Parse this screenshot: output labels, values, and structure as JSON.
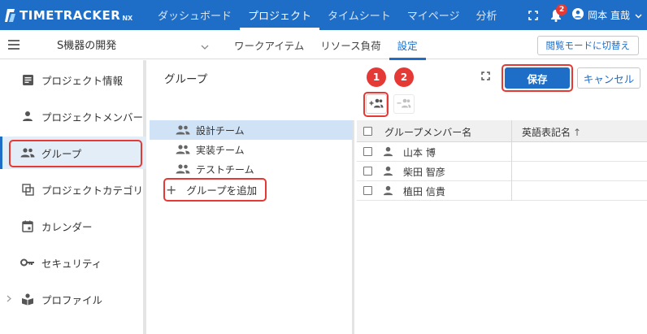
{
  "app": {
    "logo_text": "TIMETRACKER",
    "logo_suffix": "NX"
  },
  "nav": {
    "items": [
      {
        "label": "ダッシュボード"
      },
      {
        "label": "プロジェクト"
      },
      {
        "label": "タイムシート"
      },
      {
        "label": "マイページ"
      },
      {
        "label": "分析"
      }
    ],
    "active_index": 1
  },
  "topright": {
    "notification_count": "2",
    "user_name": "岡本 直哉"
  },
  "subbar": {
    "project_name": "S機器の開発",
    "tabs": [
      {
        "label": "ワークアイテム"
      },
      {
        "label": "リソース負荷"
      },
      {
        "label": "設定"
      }
    ],
    "active_tab": 2,
    "browse_mode_label": "閲覧モードに切替え"
  },
  "sidebar": {
    "items": [
      {
        "label": "プロジェクト情報",
        "icon": "document-icon"
      },
      {
        "label": "プロジェクトメンバー",
        "icon": "person-icon"
      },
      {
        "label": "グループ",
        "icon": "group-icon"
      },
      {
        "label": "プロジェクトカテゴリ",
        "icon": "category-icon"
      },
      {
        "label": "カレンダー",
        "icon": "calendar-icon"
      },
      {
        "label": "セキュリティ",
        "icon": "key-icon"
      },
      {
        "label": "プロファイル",
        "icon": "profile-icon"
      }
    ],
    "active_index": 2
  },
  "main": {
    "title": "グループ",
    "callout_1": "1",
    "callout_2": "2",
    "save_label": "保存",
    "cancel_label": "キャンセル",
    "groups": [
      {
        "name": "設計チーム"
      },
      {
        "name": "実装チーム"
      },
      {
        "name": "テストチーム"
      }
    ],
    "active_group": 0,
    "add_group_label": "グループを追加",
    "grid": {
      "col_member": "グループメンバー名",
      "col_english": "英語表記名",
      "sort_indicator": "↑",
      "rows": [
        {
          "name": "山本 博"
        },
        {
          "name": "柴田 智彦"
        },
        {
          "name": "植田 信貴"
        }
      ]
    }
  },
  "colors": {
    "primary": "#1e6ec8",
    "highlight": "#e53935",
    "selected_bg": "#cfe2f6"
  }
}
